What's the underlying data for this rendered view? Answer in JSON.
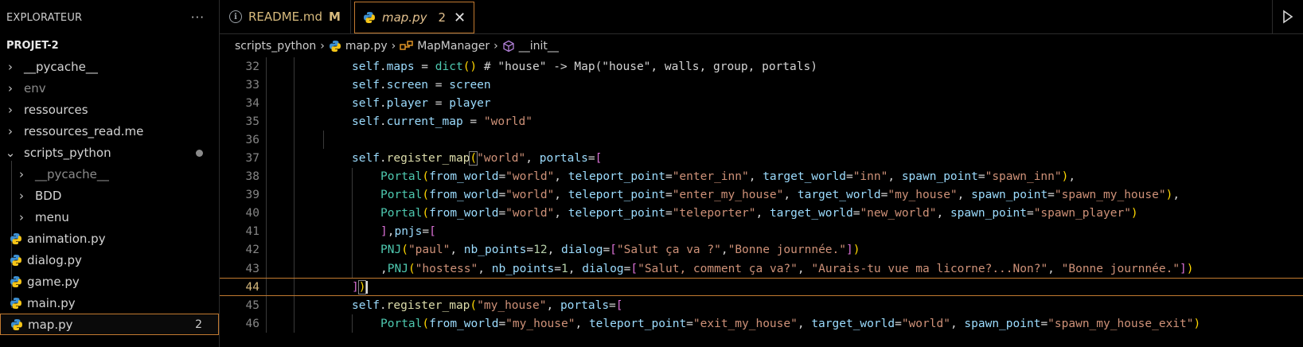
{
  "sidebar": {
    "title": "EXPLORATEUR",
    "more": "···",
    "project": "PROJET-2",
    "items": [
      {
        "name": "__pycache__",
        "type": "folder",
        "level": 0,
        "dim": false
      },
      {
        "name": "env",
        "type": "folder",
        "level": 0,
        "dim": true
      },
      {
        "name": "ressources",
        "type": "folder",
        "level": 0,
        "dim": false
      },
      {
        "name": "ressources_read.me",
        "type": "folder",
        "level": 0,
        "dim": false
      },
      {
        "name": "scripts_python",
        "type": "folder-open",
        "level": 0,
        "dim": false
      },
      {
        "name": "__pycache__",
        "type": "folder",
        "level": 1,
        "dim": true
      },
      {
        "name": "BDD",
        "type": "folder",
        "level": 1,
        "dim": false
      },
      {
        "name": "menu",
        "type": "folder",
        "level": 1,
        "dim": false
      },
      {
        "name": "animation.py",
        "type": "file",
        "level": 1,
        "dim": false
      },
      {
        "name": "dialog.py",
        "type": "file",
        "level": 1,
        "dim": false
      },
      {
        "name": "game.py",
        "type": "file",
        "level": 1,
        "dim": false
      },
      {
        "name": "main.py",
        "type": "file",
        "level": 1,
        "dim": false
      },
      {
        "name": "map.py",
        "type": "file",
        "level": 1,
        "dim": false,
        "badge": "2"
      }
    ]
  },
  "tabs": [
    {
      "label": "README.md",
      "modified": "M"
    },
    {
      "label": "map.py",
      "count": "2",
      "close": "✕"
    }
  ],
  "breadcrumb": {
    "folder": "scripts_python",
    "file": "map.py",
    "cls": "MapManager",
    "method": "__init__"
  },
  "code": {
    "line_numbers": [
      "32",
      "33",
      "34",
      "35",
      "36",
      "37",
      "38",
      "39",
      "40",
      "41",
      "42",
      "43",
      "44",
      "45",
      "46"
    ],
    "current_line": "44"
  },
  "colors": {
    "accent": "#c27a30",
    "modified": "#d7ba7d",
    "python_blue": "#3572A5",
    "python_yellow": "#FFD43B"
  }
}
